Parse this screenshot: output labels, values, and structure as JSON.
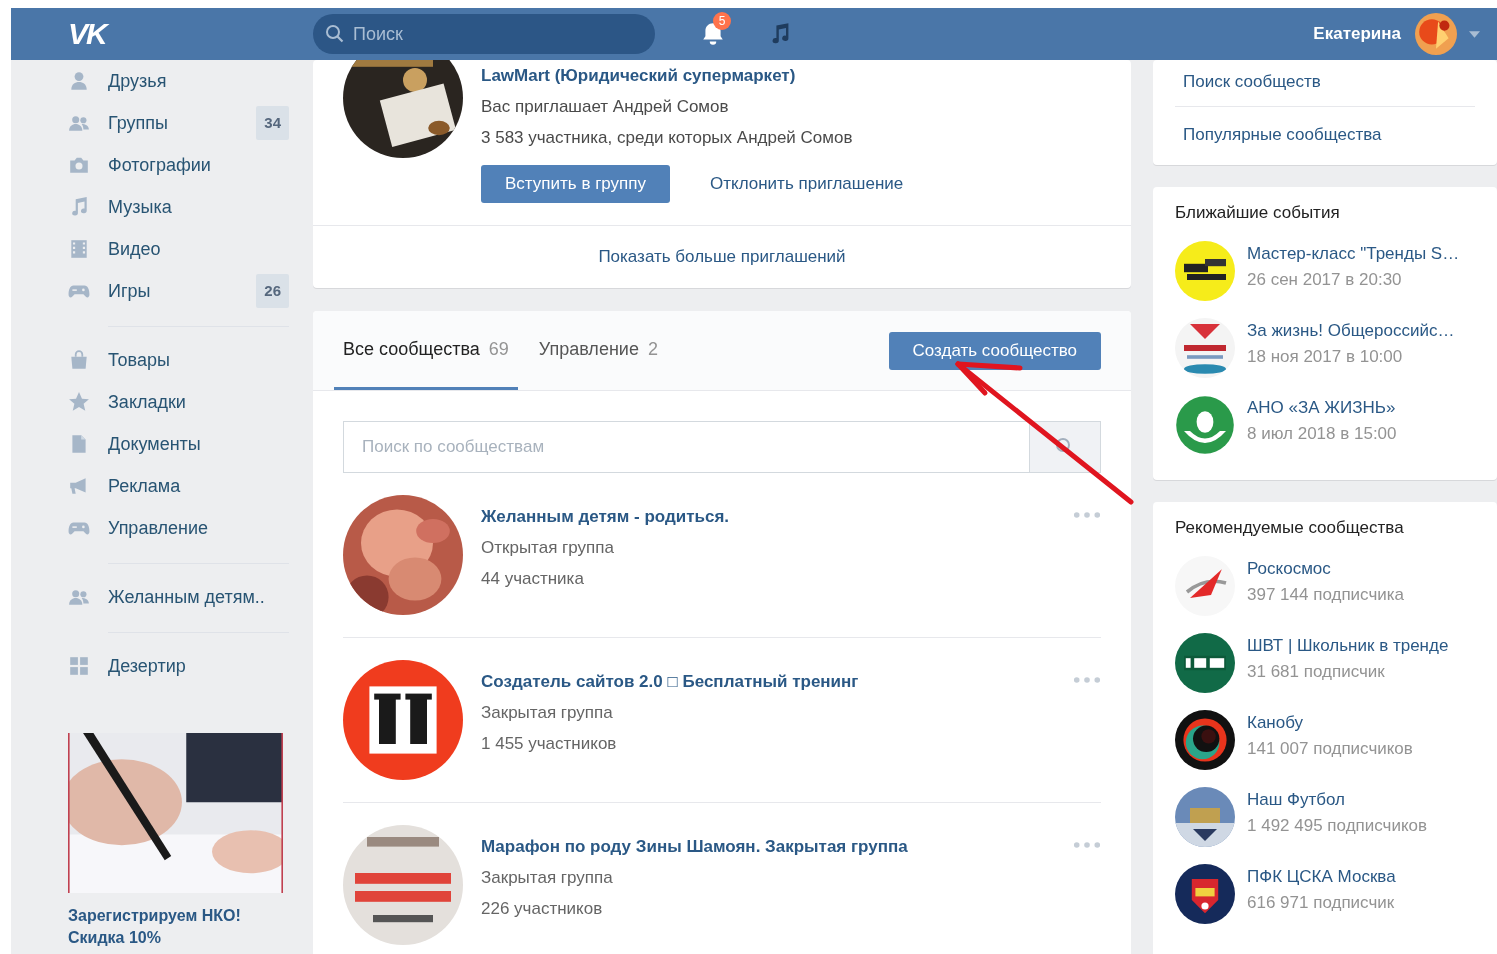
{
  "header": {
    "logo": "VK",
    "search": {
      "placeholder": "Поиск"
    },
    "notifications": {
      "count": "5"
    },
    "user": {
      "name": "Екатерина"
    }
  },
  "sidebar": {
    "sections": [
      {
        "items": [
          {
            "label": "Друзья"
          },
          {
            "label": "Группы",
            "count": "34"
          },
          {
            "label": "Фотографии"
          },
          {
            "label": "Музыка"
          },
          {
            "label": "Видео"
          },
          {
            "label": "Игры",
            "count": "26"
          }
        ]
      },
      {
        "items": [
          {
            "label": "Товары"
          },
          {
            "label": "Закладки"
          },
          {
            "label": "Документы"
          },
          {
            "label": "Реклама"
          },
          {
            "label": "Управление"
          }
        ]
      },
      {
        "items": [
          {
            "label": "Желанным детям.."
          }
        ]
      },
      {
        "items": [
          {
            "label": "Дезертир"
          }
        ]
      }
    ],
    "ad": {
      "kind": "picture",
      "text": "Зарегистрируем НКО! Скидка 10%"
    }
  },
  "invitation": {
    "title": "LawMart (Юридический супермаркет)",
    "inviter": "Вас приглашает Андрей Сомов",
    "members": "3 583 участника, среди которых Андрей Сомов",
    "join_button": "Вступить в группу",
    "decline_link": "Отклонить приглашение",
    "more_link": "Показать больше приглашений"
  },
  "communities": {
    "tabs": [
      {
        "label": "Все сообщества",
        "count": "69",
        "selected": true
      },
      {
        "label": "Управление",
        "count": "2",
        "selected": false
      }
    ],
    "create_button": "Создать сообщество",
    "search": {
      "placeholder": "Поиск по сообществам"
    },
    "items": [
      {
        "name": "Желанным детям - родиться.",
        "type": "Открытая группа",
        "members": "44 участника"
      },
      {
        "name": "Создатель сайтов 2.0 □ Бесплатный тренинг",
        "type": "Закрытая группа",
        "members": "1 455 участников"
      },
      {
        "name": "Марафон по роду Зины Шамоян. Закрытая группа",
        "type": "Закрытая группа",
        "members": "226 участников"
      }
    ]
  },
  "right": {
    "links": [
      "Поиск сообществ",
      "Популярные сообщества"
    ],
    "events": {
      "title": "Ближайшие события",
      "items": [
        {
          "name": "Мастер-класс \"Тренды S…",
          "date": "26 сен 2017 в 20:30"
        },
        {
          "name": "За жизнь! Общероссийс…",
          "date": "18 ноя 2017 в 10:00"
        },
        {
          "name": "АНО «ЗА ЖИЗНЬ»",
          "date": "8 июл 2018 в 15:00"
        }
      ]
    },
    "recommended": {
      "title": "Рекомендуемые сообщества",
      "items": [
        {
          "name": "Роскосмос",
          "subscribers": "397 144 подписчика"
        },
        {
          "name": "ШВТ | Школьник в тренде",
          "subscribers": "31 681 подписчик"
        },
        {
          "name": "Канобу",
          "subscribers": "141 007 подписчиков"
        },
        {
          "name": "Наш Футбол",
          "subscribers": "1 492 495 подписчиков"
        },
        {
          "name": "ПФК ЦСКА Москва",
          "subscribers": "616 971 подписчик"
        }
      ]
    }
  }
}
